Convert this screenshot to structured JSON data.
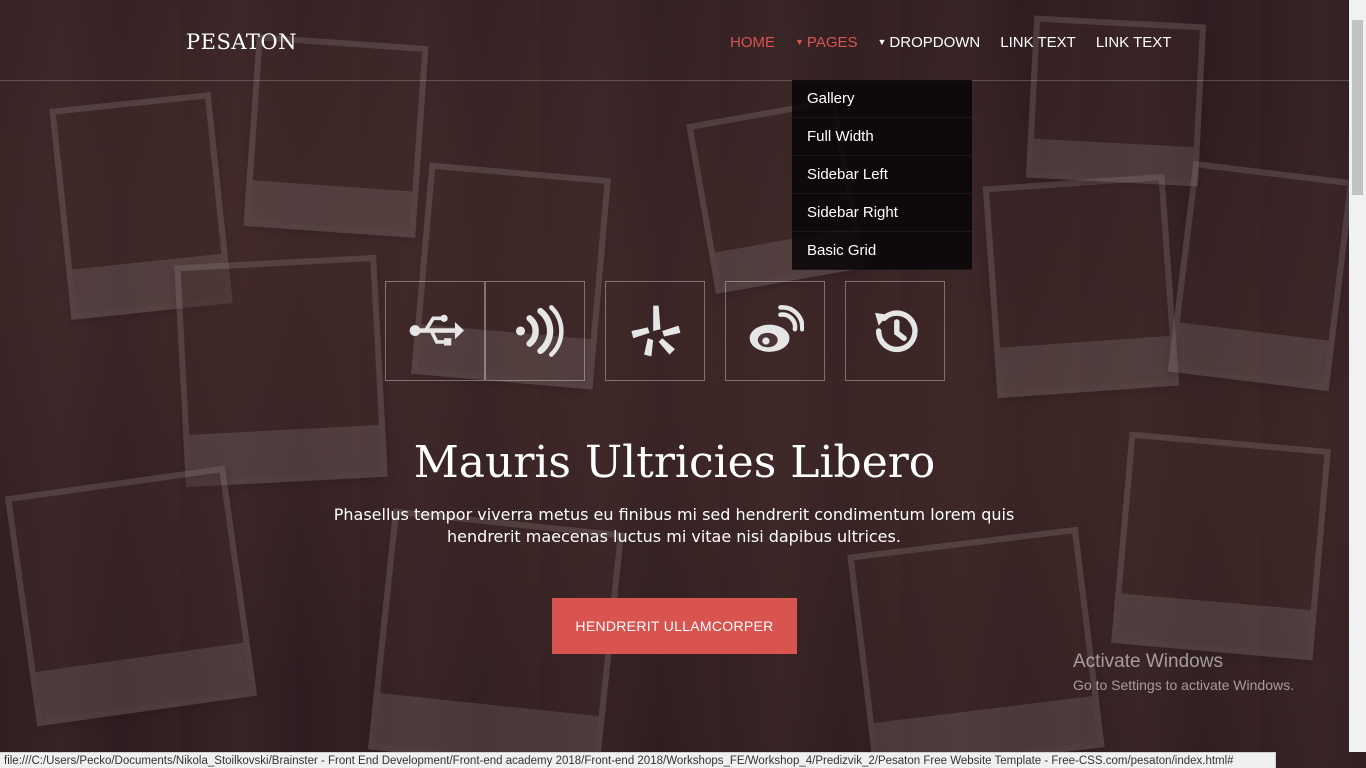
{
  "header": {
    "logo": "PESATON",
    "nav": [
      {
        "label": "HOME",
        "active": true
      },
      {
        "label": "PAGES",
        "caret": true
      },
      {
        "label": "DROPDOWN",
        "caret": true
      },
      {
        "label": "LINK TEXT"
      },
      {
        "label": "LINK TEXT"
      }
    ]
  },
  "dropdown": {
    "items": [
      "Gallery",
      "Full Width",
      "Sidebar Left",
      "Sidebar Right",
      "Basic Grid"
    ]
  },
  "icons": [
    "usb-icon",
    "rss-waves-icon",
    "yelp-icon",
    "weibo-icon",
    "history-icon"
  ],
  "hero": {
    "title": "Mauris Ultricies Libero",
    "text": "Phasellus tempor viverra metus eu finibus mi sed hendrerit condimentum lorem quis hendrerit maecenas luctus mi vitae nisi dapibus ultrices.",
    "button": "HENDRERIT ULLAMCORPER"
  },
  "watermark": {
    "line1": "Activate Windows",
    "line2": "Go to Settings to activate Windows."
  },
  "statusbar": {
    "url": "file:///C:/Users/Pecko/Documents/Nikola_Stoilkovski/Brainster - Front End Development/Front-end academy 2018/Front-end 2018/Workshops_FE/Workshop_4/Predizvik_2/Pesaton Free Website Template - Free-CSS.com/pesaton/index.html#"
  },
  "colors": {
    "accent": "#d9534f",
    "text": "#ffffff",
    "dropdown_bg": "#0a0608"
  }
}
